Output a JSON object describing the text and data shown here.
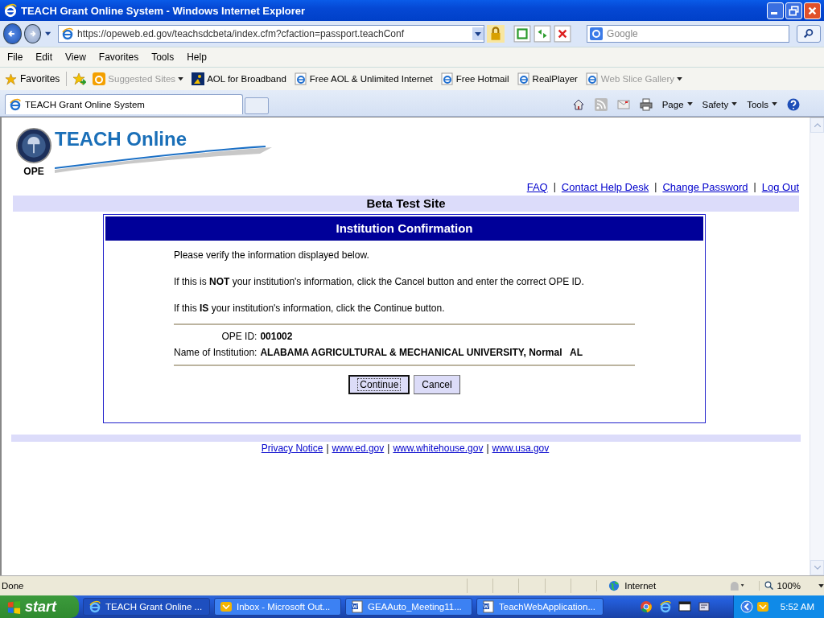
{
  "window": {
    "title": "TEACH Grant Online System - Windows Internet Explorer"
  },
  "address": {
    "url": "https://opeweb.ed.gov/teachsdcbeta/index.cfm?cfaction=passport.teachConf",
    "search_placeholder": "Google"
  },
  "menu": [
    "File",
    "Edit",
    "View",
    "Favorites",
    "Tools",
    "Help"
  ],
  "favorites": {
    "label": "Favorites",
    "links": [
      {
        "label": "Suggested Sites",
        "kind": "suggested",
        "disabled": true,
        "dropdown": true
      },
      {
        "label": "AOL for Broadband",
        "kind": "aol",
        "disabled": false,
        "dropdown": false
      },
      {
        "label": "Free AOL & Unlimited Internet",
        "kind": "ie",
        "disabled": false,
        "dropdown": false
      },
      {
        "label": "Free Hotmail",
        "kind": "ie",
        "disabled": false,
        "dropdown": false
      },
      {
        "label": "RealPlayer",
        "kind": "ie",
        "disabled": false,
        "dropdown": false
      },
      {
        "label": "Web Slice Gallery",
        "kind": "ie",
        "disabled": true,
        "dropdown": true
      }
    ]
  },
  "tabs": [
    {
      "label": "TEACH Grant Online System",
      "selected": true
    }
  ],
  "commands": [
    "Page",
    "Safety",
    "Tools"
  ],
  "page": {
    "logo_title": "TEACH Online",
    "logo_caption": "OPE",
    "nav": [
      "FAQ",
      "Contact Help Desk",
      "Change Password",
      "Log Out"
    ],
    "separator": "|",
    "banner": "Beta Test Site",
    "panel_title": "Institution Confirmation",
    "paragraphs": [
      "Please verify the information displayed below.",
      "If this is **NOT** your institution's information, click the Cancel button and enter the correct OPE ID.",
      "If this **IS** your institution's information, click the Continue button."
    ],
    "fields": [
      {
        "label": "OPE ID:",
        "value": "001002"
      },
      {
        "label": "Name of Institution:",
        "value": "ALABAMA AGRICULTURAL & MECHANICAL UNIVERSITY, Normal   AL"
      }
    ],
    "buttons": [
      {
        "label": "Continue",
        "focused": true
      },
      {
        "label": "Cancel",
        "focused": false
      }
    ],
    "footer": [
      "Privacy Notice",
      "www.ed.gov",
      "www.whitehouse.gov",
      "www.usa.gov"
    ]
  },
  "status_bar": {
    "text": "Done",
    "zone": "Internet",
    "zoom": "100%"
  },
  "taskbar": {
    "start": "start",
    "tasks": [
      {
        "label": "TEACH Grant Online ...",
        "kind": "ie",
        "selected": true
      },
      {
        "label": "Inbox - Microsoft Out...",
        "kind": "mail",
        "selected": false
      },
      {
        "label": "GEAAuto_Meeting11...",
        "kind": "word",
        "selected": false
      },
      {
        "label": "TeachWebApplication...",
        "kind": "word",
        "selected": false
      }
    ],
    "clock": "5:52 AM"
  }
}
